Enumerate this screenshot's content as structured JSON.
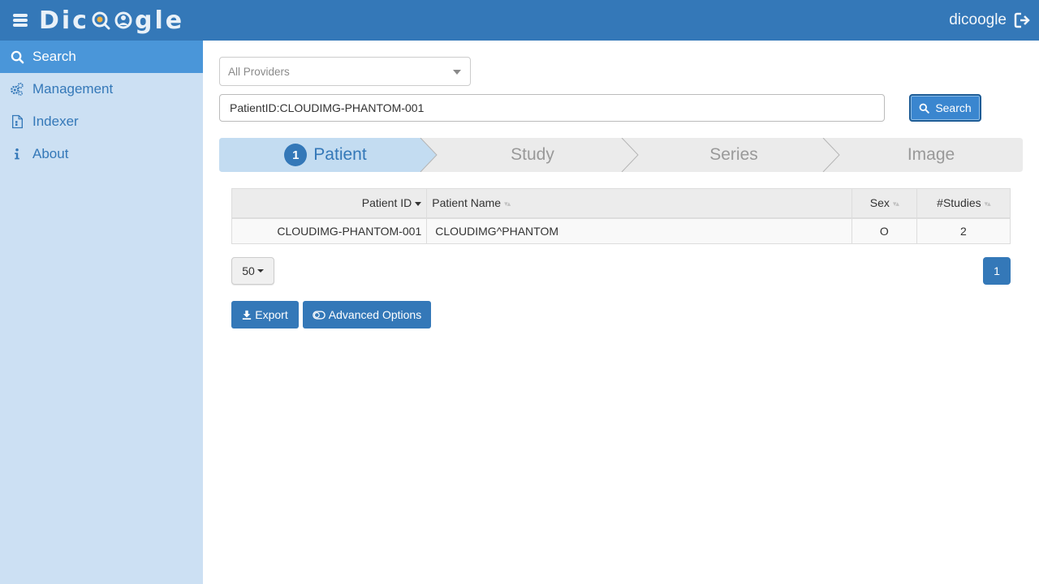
{
  "header": {
    "logo_text_left": "Dic",
    "logo_text_right": "gle",
    "user_name": "dicoogle",
    "colors": {
      "bar": "#3478b8",
      "sidebar": "#cce0f3",
      "active": "#4a96d9"
    }
  },
  "sidebar": {
    "items": [
      {
        "label": "Search",
        "icon": "search-icon",
        "active": true
      },
      {
        "label": "Management",
        "icon": "gears-icon",
        "active": false
      },
      {
        "label": "Indexer",
        "icon": "file-icon",
        "active": false
      },
      {
        "label": "About",
        "icon": "info-icon",
        "active": false
      }
    ]
  },
  "search": {
    "provider_placeholder": "All Providers",
    "query_value": "PatientID:CLOUDIMG-PHANTOM-001",
    "button_label": "Search"
  },
  "steps": {
    "active_number": "1",
    "items": [
      "Patient",
      "Study",
      "Series",
      "Image"
    ]
  },
  "table": {
    "columns": [
      "Patient ID",
      "Patient Name",
      "Sex",
      "#Studies"
    ],
    "rows": [
      {
        "patient_id": "CLOUDIMG-PHANTOM-001",
        "patient_name": "CLOUDIMG^PHANTOM",
        "sex": "O",
        "studies": "2"
      }
    ]
  },
  "pagination": {
    "page_size": "50",
    "current_page": "1"
  },
  "actions": {
    "export_label": "Export",
    "advanced_label": "Advanced Options"
  }
}
